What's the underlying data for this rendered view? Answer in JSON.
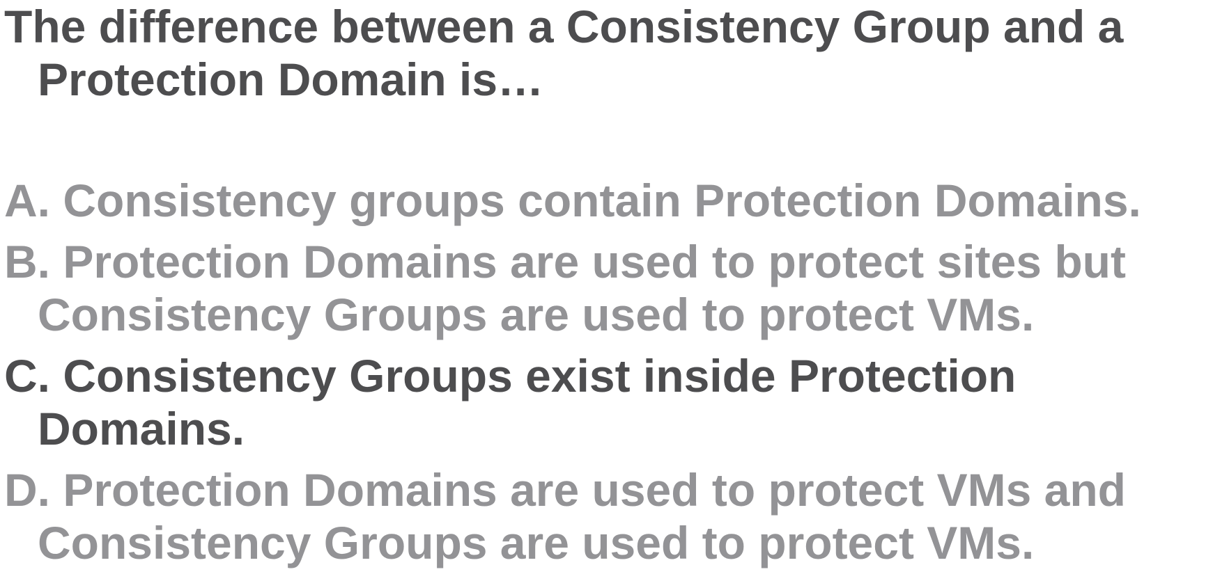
{
  "question": "The difference between a Consistency Group and a Protection Domain is…",
  "answers": [
    {
      "letter": "A.",
      "text": "Consistency groups contain Protection Domains.",
      "state": "dim"
    },
    {
      "letter": "B.",
      "text": "Protection Domains are used to protect sites but Consistency Groups are used to protect VMs.",
      "state": "dim"
    },
    {
      "letter": "C.",
      "text": "Consistency Groups exist inside Protection Domains.",
      "state": "correct"
    },
    {
      "letter": "D.",
      "text": "Protection Domains are used to protect VMs and Consistency Groups are used to protect VMs.",
      "state": "dim"
    }
  ],
  "colors": {
    "text_dark": "#4d4d4f",
    "text_dim": "#939396",
    "background": "#ffffff"
  }
}
